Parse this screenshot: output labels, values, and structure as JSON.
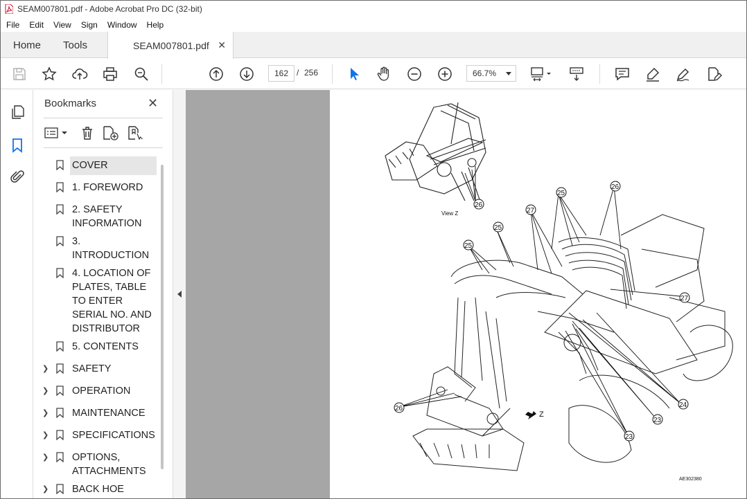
{
  "window": {
    "title": "SEAM007801.pdf - Adobe Acrobat Pro DC (32-bit)"
  },
  "menu": {
    "items": [
      "File",
      "Edit",
      "View",
      "Sign",
      "Window",
      "Help"
    ]
  },
  "tabs": {
    "home": "Home",
    "tools": "Tools",
    "document": "SEAM007801.pdf"
  },
  "toolbar": {
    "current_page": "162",
    "page_separator": "/",
    "total_pages": "256",
    "zoom": "66.7%"
  },
  "bookmarks": {
    "title": "Bookmarks",
    "items": [
      {
        "label": "COVER",
        "expandable": false,
        "selected": true
      },
      {
        "label": "1. FOREWORD",
        "expandable": false
      },
      {
        "label": "2. SAFETY INFORMATION",
        "expandable": false
      },
      {
        "label": "3. INTRODUCTION",
        "expandable": false
      },
      {
        "label": "4. LOCATION OF PLATES, TABLE TO ENTER SERIAL NO. AND DISTRIBUTOR",
        "expandable": false
      },
      {
        "label": "5. CONTENTS",
        "expandable": false
      },
      {
        "label": "SAFETY",
        "expandable": true
      },
      {
        "label": "OPERATION",
        "expandable": true
      },
      {
        "label": "MAINTENANCE",
        "expandable": true
      },
      {
        "label": "SPECIFICATIONS",
        "expandable": true
      },
      {
        "label": "OPTIONS, ATTACHMENTS",
        "expandable": true
      },
      {
        "label": "BACK HOE",
        "expandable": true
      }
    ]
  },
  "drawing": {
    "view_label": "View Z",
    "arrow_label": "Z",
    "callouts": [
      "26",
      "25",
      "26",
      "27",
      "25",
      "25",
      "27",
      "24",
      "23",
      "23",
      "26"
    ],
    "drawing_code": "AE302380"
  }
}
